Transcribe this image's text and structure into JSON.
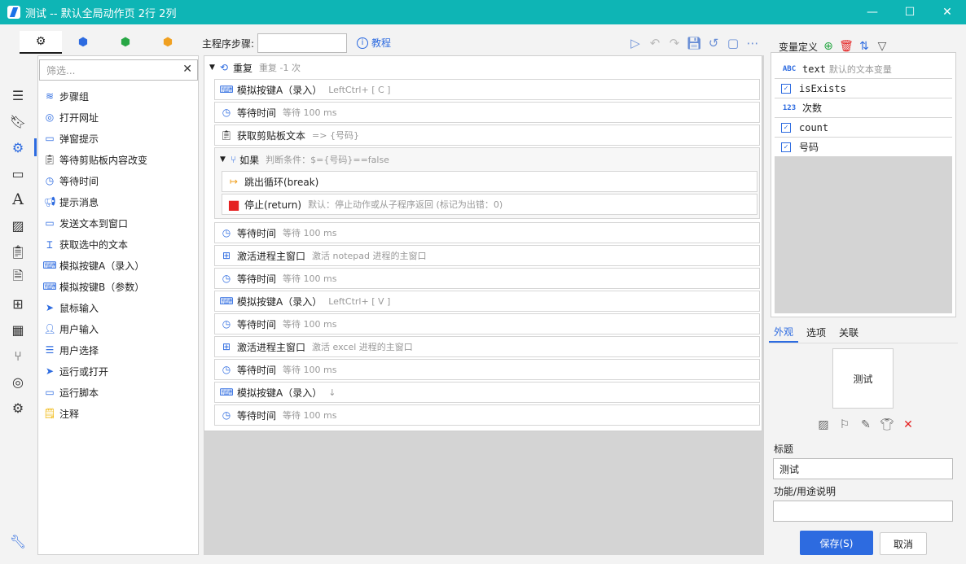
{
  "window": {
    "title": "测试 -- 默认全局动作页 2行 2列",
    "minimize": "—",
    "maximize": "☐",
    "close": "✕"
  },
  "rail": {
    "icons": [
      "menu-icon",
      "bookmark-icon",
      "gear-icon",
      "window-icon",
      "font-icon",
      "image-icon",
      "clipboard-icon",
      "document-icon",
      "windows-icon",
      "grid-icon",
      "branch-icon",
      "globe-icon",
      "cogs-icon",
      "wrench-icon"
    ]
  },
  "toolbox": {
    "tabs": [
      "⚙",
      "⬢",
      "⬢",
      "⬢"
    ],
    "tab_colors": [
      "#333333",
      "#2d6be0",
      "#28a745",
      "#f0a020"
    ],
    "filter_placeholder": "筛选...",
    "clear": "✕",
    "items": [
      {
        "label": "步骤组",
        "icon": "layers-icon"
      },
      {
        "label": "打开网址",
        "icon": "globe-icon"
      },
      {
        "label": "弹窗提示",
        "icon": "popup-icon"
      },
      {
        "label": "等待剪贴板内容改变",
        "icon": "clipboard-icon"
      },
      {
        "label": "等待时间",
        "icon": "timer-icon"
      },
      {
        "label": "提示消息",
        "icon": "megaphone-icon"
      },
      {
        "label": "发送文本到窗口",
        "icon": "message-icon"
      },
      {
        "label": "获取选中的文本",
        "icon": "text-cursor-icon"
      },
      {
        "label": "模拟按键A（录入）",
        "icon": "keyboard-icon"
      },
      {
        "label": "模拟按键B（参数）",
        "icon": "keyboard-icon"
      },
      {
        "label": "鼠标输入",
        "icon": "cursor-icon"
      },
      {
        "label": "用户输入",
        "icon": "user-edit-icon"
      },
      {
        "label": "用户选择",
        "icon": "list-icon"
      },
      {
        "label": "运行或打开",
        "icon": "send-icon"
      },
      {
        "label": "运行脚本",
        "icon": "script-icon"
      },
      {
        "label": "注释",
        "icon": "note-icon"
      }
    ]
  },
  "toolbar": {
    "step_label": "主程序步骤:",
    "step_value": "",
    "tutorial": "教程",
    "icons": [
      "play-icon",
      "undo-icon",
      "redo-icon",
      "save-icon",
      "history-icon",
      "note-icon",
      "more-icon"
    ]
  },
  "steps": {
    "repeat": {
      "title": "重复",
      "desc": "重复 -1 次"
    },
    "items": [
      {
        "label": "模拟按键A（录入）",
        "desc": "LeftCtrl+ [ C ]",
        "icon": "keyboard-icon"
      },
      {
        "label": "等待时间",
        "desc": "等待 100 ms",
        "icon": "timer-icon"
      },
      {
        "label": "获取剪贴板文本",
        "desc": "=> {号码}",
        "icon": "clipboard-icon"
      }
    ],
    "if_block": {
      "title": "如果",
      "desc": "判断条件：$={号码}==false",
      "items": [
        {
          "label": "跳出循环(break)",
          "desc": "",
          "icon": "break-icon"
        },
        {
          "label": "停止(return)",
          "desc": "默认：停止动作或从子程序返回 (标记为出错：0)",
          "icon": "stop-icon"
        }
      ]
    },
    "after": [
      {
        "label": "等待时间",
        "desc": "等待 100 ms",
        "icon": "timer-icon"
      },
      {
        "label": "激活进程主窗口",
        "desc": "激活 notepad 进程的主窗口",
        "icon": "windows-icon"
      },
      {
        "label": "等待时间",
        "desc": "等待 100 ms",
        "icon": "timer-icon"
      },
      {
        "label": "模拟按键A（录入）",
        "desc": "LeftCtrl+ [ V ]",
        "icon": "keyboard-icon"
      },
      {
        "label": "等待时间",
        "desc": "等待 100 ms",
        "icon": "timer-icon"
      },
      {
        "label": "激活进程主窗口",
        "desc": "激活 excel 进程的主窗口",
        "icon": "windows-icon"
      },
      {
        "label": "等待时间",
        "desc": "等待 100 ms",
        "icon": "timer-icon"
      },
      {
        "label": "模拟按键A（录入）",
        "desc": "↓",
        "icon": "keyboard-icon"
      },
      {
        "label": "等待时间",
        "desc": "等待 100 ms",
        "icon": "timer-icon"
      }
    ]
  },
  "variables": {
    "header": "变量定义",
    "items": [
      {
        "name": "text",
        "desc": "默认的文本变量",
        "type": "ABC"
      },
      {
        "name": "isExists",
        "desc": "",
        "type": "bool"
      },
      {
        "name": "次数",
        "desc": "",
        "type": "123"
      },
      {
        "name": "count",
        "desc": "",
        "type": "bool"
      },
      {
        "name": "号码",
        "desc": "",
        "type": "bool"
      }
    ]
  },
  "properties": {
    "tabs": [
      "外观",
      "选项",
      "关联"
    ],
    "active_tab": "外观",
    "preview_text": "测试",
    "title_label": "标题",
    "title_value": "测试",
    "desc_label": "功能/用途说明",
    "desc_value": "",
    "save": "保存(S)",
    "cancel": "取消"
  },
  "colors": {
    "titlebar": "#0eb5b5",
    "accent": "#2d6be0",
    "stop": "#e52222"
  }
}
